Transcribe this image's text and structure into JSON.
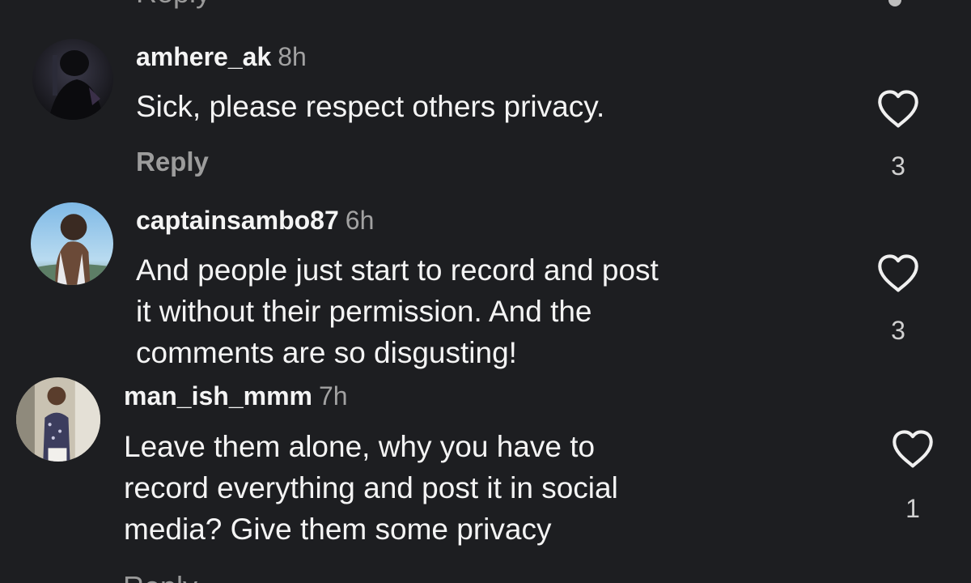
{
  "top_cut_text": "Reply",
  "bottom_cut_text": "Reply",
  "comments": [
    {
      "username": "amhere_ak",
      "time": "8h",
      "lines": [
        "Sick, please respect others privacy."
      ],
      "reply_label": "Reply",
      "likes": "3",
      "avatar_icon": "user-avatar-icon"
    },
    {
      "username": "captainsambo87",
      "time": "6h",
      "lines": [
        "And people just start to record and post",
        "it without their permission. And the",
        "comments are so disgusting!"
      ],
      "likes": "3",
      "avatar_icon": "user-avatar-icon"
    },
    {
      "username": "man_ish_mmm",
      "time": "7h",
      "lines": [
        "Leave them alone, why you have to",
        "record everything and post it in social",
        "media? Give them some privacy"
      ],
      "likes": "1",
      "avatar_icon": "user-avatar-icon"
    }
  ],
  "colors": {
    "background": "#1d1e21",
    "text": "#f4f4f4",
    "secondary_text": "#9c9c9c"
  },
  "icons": {
    "like": "heart-outline-icon",
    "more": "dot-icon"
  }
}
